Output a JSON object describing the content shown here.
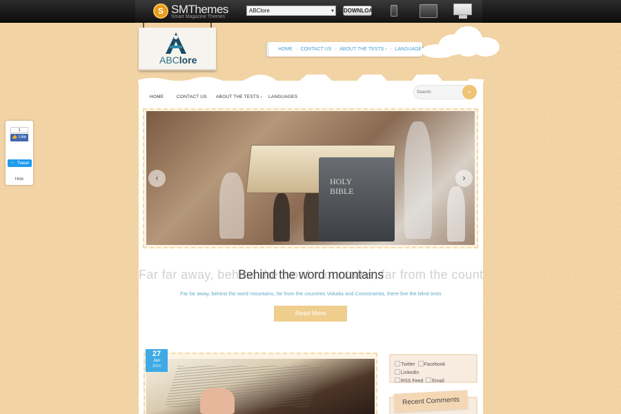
{
  "topbar": {
    "brand": "SMThemes",
    "tagline": "Smart Magazine Themes",
    "theme_select_value": "ABClore",
    "download_label": "DOWNLOAD"
  },
  "site": {
    "logo_text_light": "ABC",
    "logo_text_bold": "lore"
  },
  "top_nav": [
    "HOME",
    "CONTACT US",
    "ABOUT THE TESTS ›",
    "LANGUAGES"
  ],
  "main_nav": [
    "HOME",
    "CONTACT US",
    "ABOUT THE TESTS ›",
    "LANGUAGES"
  ],
  "search": {
    "placeholder": "Search"
  },
  "slider": {
    "book_label": "HOLY\nBIBLE"
  },
  "featured": {
    "title": "Behind the word mountains",
    "ghost_title": "Far far away, behind the word mountains, far from the countries Vokalia",
    "excerpt": "Far far away, behind the word mountains, far from the countries Vokalia and Consonantia, there live the blind texts",
    "read_more": "Read More"
  },
  "post": {
    "date_day": "27",
    "date_month": "Jan",
    "date_year": "2016"
  },
  "sidebar": {
    "social_links": [
      "Twitter",
      "Facebook",
      "LinkedIn",
      "RSS Feed",
      "Email"
    ],
    "recent_comments_title": "Recent Comments"
  },
  "share_widget": {
    "fb_count": "1",
    "fb_like": "Like",
    "tweet": "Tweet",
    "hide": "Hide"
  },
  "colors": {
    "accent_gold": "#efc473",
    "link_blue": "#4aa0d0",
    "date_badge": "#3fa9e6",
    "page_bg": "#f1d3a4"
  }
}
